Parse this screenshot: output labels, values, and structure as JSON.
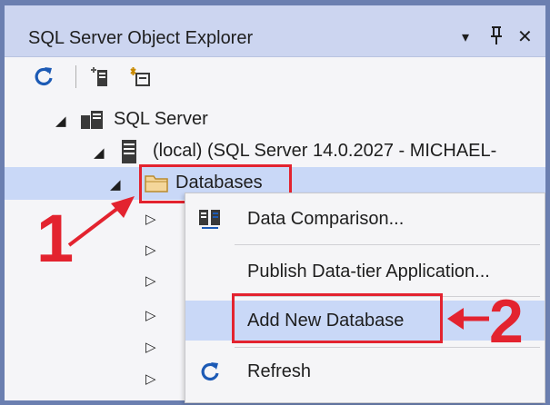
{
  "window": {
    "title": "SQL Server Object Explorer",
    "dropdown_glyph": "▾",
    "pin_glyph": "Ч",
    "close_glyph": "✕"
  },
  "toolbar": {
    "icons": [
      "refresh-icon",
      "add-sql-server-icon",
      "new-query-icon"
    ]
  },
  "tree": {
    "expander_open": "◢",
    "expander_closed": "▷",
    "nodes": [
      {
        "label": "SQL Server",
        "icon": "server-group-icon"
      },
      {
        "label": "(local) (SQL Server 14.0.2027 - MICHAEL-",
        "icon": "server-instance-icon"
      },
      {
        "label": "Databases",
        "icon": "folder-icon"
      }
    ]
  },
  "context_menu": {
    "items": [
      {
        "label": "Data Comparison...",
        "icon": "data-comparison-icon"
      },
      {
        "label": "Publish Data-tier Application...",
        "icon": ""
      },
      {
        "label": "Add New Database",
        "icon": ""
      },
      {
        "label": "Refresh",
        "icon": "refresh-icon"
      }
    ]
  },
  "annotations": {
    "step1": "1",
    "step2": "2",
    "color": "#e3232f"
  }
}
